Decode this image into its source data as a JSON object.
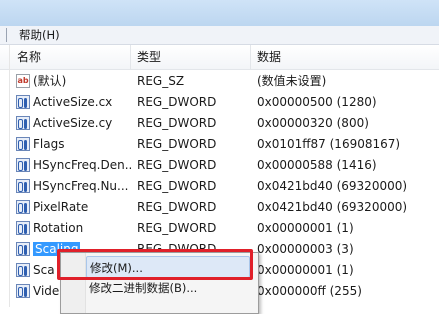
{
  "menu": {
    "items": [
      {
        "label": "帮助(H)"
      }
    ]
  },
  "columns": {
    "name": "名称",
    "type": "类型",
    "data": "数据"
  },
  "rows": [
    {
      "icon": "string-value-icon",
      "name": "(默认)",
      "type": "REG_SZ",
      "data": "(数值未设置)"
    },
    {
      "icon": "binary-value-icon",
      "name": "ActiveSize.cx",
      "type": "REG_DWORD",
      "data": "0x00000500 (1280)"
    },
    {
      "icon": "binary-value-icon",
      "name": "ActiveSize.cy",
      "type": "REG_DWORD",
      "data": "0x00000320 (800)"
    },
    {
      "icon": "binary-value-icon",
      "name": "Flags",
      "type": "REG_DWORD",
      "data": "0x0101ff87 (16908167)"
    },
    {
      "icon": "binary-value-icon",
      "name": "HSyncFreq.Den...",
      "type": "REG_DWORD",
      "data": "0x00000588 (1416)"
    },
    {
      "icon": "binary-value-icon",
      "name": "HSyncFreq.Nu...",
      "type": "REG_DWORD",
      "data": "0x0421bd40 (69320000)"
    },
    {
      "icon": "binary-value-icon",
      "name": "PixelRate",
      "type": "REG_DWORD",
      "data": "0x0421bd40 (69320000)"
    },
    {
      "icon": "binary-value-icon",
      "name": "Rotation",
      "type": "REG_DWORD",
      "data": "0x00000001 (1)"
    },
    {
      "icon": "binary-value-icon",
      "name": "Scaling",
      "type": "REG_DWORD",
      "data": "0x00000003 (3)",
      "selected": true
    },
    {
      "icon": "binary-value-icon",
      "name": "Sca",
      "type": "",
      "data": "0x00000001 (1)"
    },
    {
      "icon": "binary-value-icon",
      "name": "Vide",
      "type": "",
      "data": "0x000000ff (255)"
    }
  ],
  "context_menu": {
    "items": [
      {
        "label": "修改(M)..."
      },
      {
        "label": "修改二进制数据(B)..."
      }
    ]
  }
}
